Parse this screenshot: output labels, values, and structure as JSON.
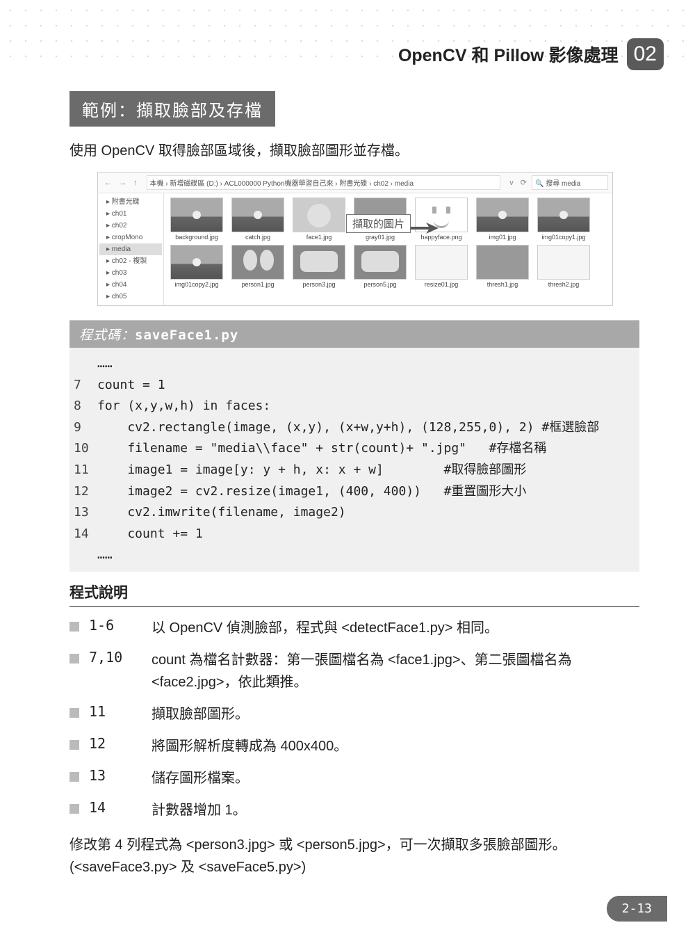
{
  "header": {
    "title": "OpenCV 和 Pillow 影像處理",
    "chapter": "02"
  },
  "section": {
    "title": "範例：擷取臉部及存檔",
    "intro": "使用 OpenCV 取得臉部區域後，擷取臉部圖形並存檔。"
  },
  "explorer": {
    "breadcrumb": "本機 › 新增磁碟區 (D:) › ACL000000 Python機器學習自己來 › 附書光碟 › ch02 › media",
    "search_placeholder": "搜尋 media",
    "tree": [
      "附書光碟",
      "ch01",
      "ch02",
      "cropMono",
      "media",
      "ch02 - 複製",
      "ch03",
      "ch04",
      "ch05"
    ],
    "tree_selected": "media",
    "thumbs_row1": [
      {
        "name": "background.jpg",
        "cls": "sunset"
      },
      {
        "name": "catch.jpg",
        "cls": "sunset"
      },
      {
        "name": "face1.jpg",
        "cls": "face"
      },
      {
        "name": "gray01.jpg",
        "cls": "gray"
      },
      {
        "name": "happyface.png",
        "cls": "happy"
      },
      {
        "name": "img01.jpg",
        "cls": "sunset"
      },
      {
        "name": "img01copy1.jpg",
        "cls": "sunset"
      }
    ],
    "thumbs_row2": [
      {
        "name": "img01copy2.jpg",
        "cls": "sunset"
      },
      {
        "name": "person1.jpg",
        "cls": "face2"
      },
      {
        "name": "person3.jpg",
        "cls": "face3"
      },
      {
        "name": "person5.jpg",
        "cls": "face3"
      },
      {
        "name": "resize01.jpg",
        "cls": "white"
      },
      {
        "name": "thresh1.jpg",
        "cls": "gray"
      },
      {
        "name": "thresh2.jpg",
        "cls": "white"
      }
    ],
    "callout": "擷取的圖片"
  },
  "code": {
    "header_label": "程式碼：",
    "filename": "saveFace1.py",
    "lines": [
      {
        "n": "",
        "t": "……"
      },
      {
        "n": "7",
        "t": "count = 1"
      },
      {
        "n": "8",
        "t": "for (x,y,w,h) in faces:"
      },
      {
        "n": "9",
        "t": "    cv2.rectangle(image, (x,y), (x+w,y+h), (128,255,0), 2) #框選臉部"
      },
      {
        "n": "10",
        "t": "    filename = \"media\\\\face\" + str(count)+ \".jpg\"   #存檔名稱"
      },
      {
        "n": "11",
        "t": "    image1 = image[y: y + h, x: x + w]        #取得臉部圖形"
      },
      {
        "n": "12",
        "t": "    image2 = cv2.resize(image1, (400, 400))   #重置圖形大小"
      },
      {
        "n": "13",
        "t": "    cv2.imwrite(filename, image2)"
      },
      {
        "n": "14",
        "t": "    count += 1"
      },
      {
        "n": "",
        "t": "……"
      }
    ]
  },
  "explain": {
    "title": "程式說明",
    "items": [
      {
        "ln": "1-6",
        "text": "以 OpenCV 偵測臉部，程式與 <detectFace1.py> 相同。"
      },
      {
        "ln": "7,10",
        "text": "count 為檔名計數器：第一張圖檔名為 <face1.jpg>、第二張圖檔名為 <face2.jpg>，依此類推。"
      },
      {
        "ln": "11",
        "text": "擷取臉部圖形。"
      },
      {
        "ln": "12",
        "text": "將圖形解析度轉成為 400x400。"
      },
      {
        "ln": "13",
        "text": "儲存圖形檔案。"
      },
      {
        "ln": "14",
        "text": "計數器增加 1。"
      }
    ]
  },
  "footnote": "修改第 4 列程式為 <person3.jpg> 或 <person5.jpg>，可一次擷取多張臉部圖形。(<saveFace3.py> 及 <saveFace5.py>)",
  "page_number": "2-13"
}
